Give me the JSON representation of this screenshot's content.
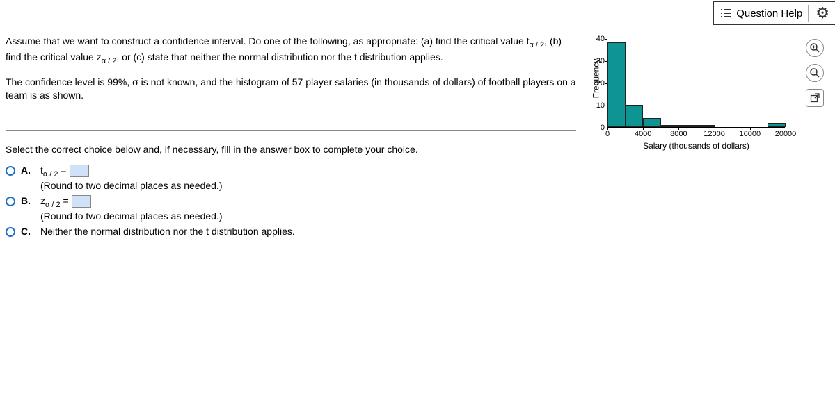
{
  "header": {
    "question_help": "Question Help"
  },
  "question": {
    "para1_a": "Assume that we want to construct a confidence interval. Do one of the following, as appropriate: (a) find the critical value t",
    "para1_sub1": "α / 2",
    "para1_b": ", (b) find the critical value z",
    "para1_sub2": "α / 2",
    "para1_c": ", or (c) state that neither the normal distribution nor the t distribution applies.",
    "para2": "The confidence level is 99%, σ is not known, and the histogram of 57 player salaries (in thousands of dollars) of football players on a team is as shown."
  },
  "prompt": "Select the correct choice below and, if necessary, fill in the answer box to complete your choice.",
  "choices": {
    "a_letter": "A.",
    "a_sym": "t",
    "a_sub": "α / 2",
    "a_eq": " = ",
    "a_note": "(Round to two decimal places as needed.)",
    "b_letter": "B.",
    "b_sym": "z",
    "b_sub": "α / 2",
    "b_eq": " = ",
    "b_note": "(Round to two decimal places as needed.)",
    "c_letter": "C.",
    "c_text": "Neither the normal distribution nor the t distribution applies."
  },
  "chart_data": {
    "type": "bar",
    "title": "",
    "xlabel": "Salary (thousands of dollars)",
    "ylabel": "Frequency",
    "ylim": [
      0,
      40
    ],
    "yticks": [
      0,
      10,
      20,
      30,
      40
    ],
    "xticks": [
      0,
      4000,
      8000,
      12000,
      16000,
      20000
    ],
    "bin_width": 2000,
    "categories": [
      1000,
      3000,
      5000,
      7000,
      9000,
      11000,
      13000,
      15000,
      17000,
      19000
    ],
    "values": [
      38,
      10,
      4,
      1,
      1,
      1,
      0,
      0,
      0,
      2
    ]
  }
}
